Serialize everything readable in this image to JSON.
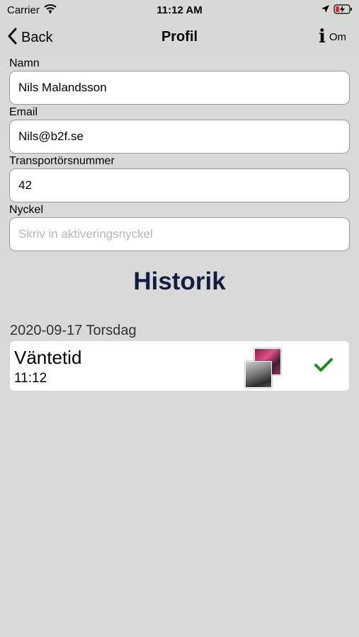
{
  "status_bar": {
    "carrier": "Carrier",
    "time": "11:12 AM"
  },
  "nav": {
    "back_label": "Back",
    "title": "Profil",
    "info_label": "Om"
  },
  "form": {
    "fields": [
      {
        "label": "Namn",
        "value": "Nils Malandsson",
        "placeholder": ""
      },
      {
        "label": "Email",
        "value": "Nils@b2f.se",
        "placeholder": ""
      },
      {
        "label": "Transportörsnummer",
        "value": "42",
        "placeholder": ""
      },
      {
        "label": "Nyckel",
        "value": "",
        "placeholder": "Skriv in aktiveringsnyckel"
      }
    ]
  },
  "history": {
    "title": "Historik",
    "groups": [
      {
        "date": "2020-09-17 Torsdag",
        "items": [
          {
            "title": "Väntetid",
            "time": "11:12",
            "status_icon": "checkmark-icon",
            "status_color": "#1f8a1f"
          }
        ]
      }
    ]
  },
  "colors": {
    "background": "#d9d9d9",
    "header": "#d6d9d4",
    "history_title": "#112040",
    "check": "#1f8a1f"
  }
}
